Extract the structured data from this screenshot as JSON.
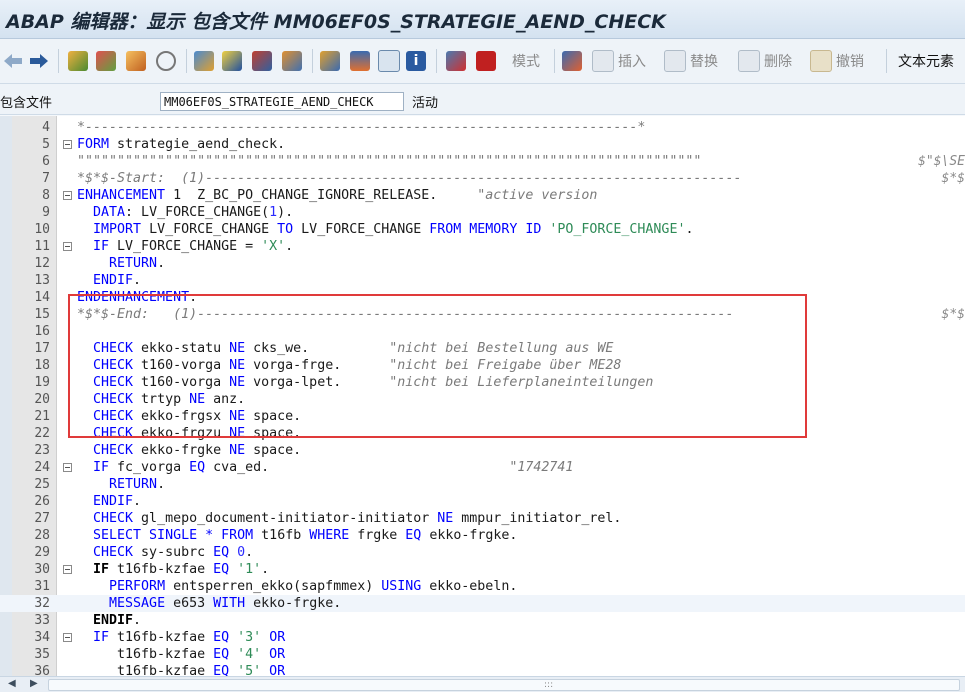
{
  "window": {
    "title": "ABAP 编辑器：显示 包含文件 MM06EF0S_STRATEGIE_AEND_CHECK"
  },
  "toolbar": {
    "buttons": [
      {
        "name": "back-icon",
        "label": ""
      },
      {
        "name": "forward-icon",
        "label": ""
      },
      {
        "name": "mode-button",
        "label": "模式"
      },
      {
        "name": "insert-button",
        "label": "插入"
      },
      {
        "name": "replace-button",
        "label": "替换"
      },
      {
        "name": "delete-button",
        "label": "删除"
      },
      {
        "name": "undo-button",
        "label": "撤销"
      },
      {
        "name": "text-elements-button",
        "label": "文本元素"
      }
    ]
  },
  "infobar": {
    "label": "包含文件",
    "program": "MM06EF0S_STRATEGIE_AEND_CHECK",
    "status": "活动"
  },
  "editor": {
    "lines": [
      {
        "n": "4",
        "html": "<span class='cmt'>*---------------------------------------------------------------------*</span>"
      },
      {
        "n": "5",
        "html": "<span class='kw'>FORM</span> strategie_aend_check.",
        "fold": true
      },
      {
        "n": "6",
        "html": "<span class='cmt'>\"\"\"\"\"\"\"\"\"\"\"\"\"\"\"\"\"\"\"\"\"\"\"\"\"\"\"\"\"\"\"\"\"\"\"\"\"\"\"\"\"\"\"\"\"\"\"\"\"\"\"\"\"\"\"\"\"\"\"\"\"\"\"\"\"\"\"\"\"\"\"\"\"\"\"\"\"\"</span>",
        "rc": "$\"$\\SE"
      },
      {
        "n": "7",
        "html": "<span class='cmt'>*$*$-Start:  (1)-------------------------------------------------------------------</span>",
        "rc": "$*$"
      },
      {
        "n": "8",
        "html": "<span class='kw'>ENHANCEMENT</span> 1  Z_BC_PO_CHANGE_IGNORE_RELEASE.     <span class='cmt'>\"active version</span>",
        "fold": true
      },
      {
        "n": "9",
        "html": "  <span class='kw'>DATA</span>: LV_FORCE_CHANGE(<span class='num'>1</span>)."
      },
      {
        "n": "10",
        "html": "  <span class='kw'>IMPORT</span> LV_FORCE_CHANGE <span class='kw'>TO</span> LV_FORCE_CHANGE <span class='kw'>FROM MEMORY ID</span> <span class='str'>'PO_FORCE_CHANGE'</span>."
      },
      {
        "n": "11",
        "html": "  <span class='kw'>IF</span> LV_FORCE_CHANGE = <span class='str'>'X'</span>.",
        "fold": true
      },
      {
        "n": "12",
        "html": "    <span class='kw'>RETURN</span>."
      },
      {
        "n": "13",
        "html": "  <span class='kw'>ENDIF</span>."
      },
      {
        "n": "14",
        "html": "<span class='kw'>ENDENHANCEMENT</span>."
      },
      {
        "n": "15",
        "html": "<span class='cmt'>*$*$-End:   (1)-------------------------------------------------------------------</span>",
        "rc": "$*$"
      },
      {
        "n": "16",
        "html": ""
      },
      {
        "n": "17",
        "html": "  <span class='kw'>CHECK</span> ekko-statu <span class='kw'>NE</span> cks_we.          <span class='cmt'>\"nicht bei Bestellung aus WE</span>"
      },
      {
        "n": "18",
        "html": "  <span class='kw'>CHECK</span> t160-vorga <span class='kw'>NE</span> vorga-frge.      <span class='cmt'>\"nicht bei Freigabe über ME28</span>"
      },
      {
        "n": "19",
        "html": "  <span class='kw'>CHECK</span> t160-vorga <span class='kw'>NE</span> vorga-lpet.      <span class='cmt'>\"nicht bei Lieferplaneinteilungen</span>"
      },
      {
        "n": "20",
        "html": "  <span class='kw'>CHECK</span> trtyp <span class='kw'>NE</span> anz."
      },
      {
        "n": "21",
        "html": "  <span class='kw'>CHECK</span> ekko-frgsx <span class='kw'>NE</span> space."
      },
      {
        "n": "22",
        "html": "  <span class='kw'>CHECK</span> ekko-frgzu <span class='kw'>NE</span> space."
      },
      {
        "n": "23",
        "html": "  <span class='kw'>CHECK</span> ekko-frgke <span class='kw'>NE</span> space."
      },
      {
        "n": "24",
        "html": "  <span class='kw'>IF</span> fc_vorga <span class='kw'>EQ</span> cva_ed.                              <span class='cmt'>\"1742741</span>",
        "fold": true
      },
      {
        "n": "25",
        "html": "    <span class='kw'>RETURN</span>."
      },
      {
        "n": "26",
        "html": "  <span class='kw'>ENDIF</span>."
      },
      {
        "n": "27",
        "html": "  <span class='kw'>CHECK</span> gl_mepo_document-initiator-initiator <span class='kw'>NE</span> mmpur_initiator_rel."
      },
      {
        "n": "28",
        "html": "  <span class='kw'>SELECT SINGLE</span> <span class='kw'>*</span> <span class='kw'>FROM</span> t16fb <span class='kw'>WHERE</span> frgke <span class='kw'>EQ</span> ekko-frgke."
      },
      {
        "n": "29",
        "html": "  <span class='kw'>CHECK</span> sy-subrc <span class='kw'>EQ</span> <span class='num'>0</span>."
      },
      {
        "n": "30",
        "html": "  <span class='bold'>IF</span> t16fb-kzfae <span class='kw'>EQ</span> <span class='str'>'1'</span>.",
        "fold": true
      },
      {
        "n": "31",
        "html": "    <span class='kw'>PERFORM</span> entsperren_ekko(sapfmmex) <span class='kw'>USING</span> ekko-ebeln."
      },
      {
        "n": "32",
        "html": "    <span class='kw'>MESSAGE</span> e653 <span class='kw'>WITH</span> ekko-frgke.",
        "hl": true
      },
      {
        "n": "33",
        "html": "  <span class='bold'>ENDIF</span>."
      },
      {
        "n": "34",
        "html": "  <span class='kw'>IF</span> t16fb-kzfae <span class='kw'>EQ</span> <span class='str'>'3'</span> <span class='kw'>OR</span>",
        "fold": true
      },
      {
        "n": "35",
        "html": "     t16fb-kzfae <span class='kw'>EQ</span> <span class='str'>'4'</span> <span class='kw'>OR</span>"
      },
      {
        "n": "36",
        "html": "     t16fb-kzfae <span class='kw'>EQ</span> <span class='str'>'5'</span> <span class='kw'>OR</span>"
      }
    ]
  }
}
